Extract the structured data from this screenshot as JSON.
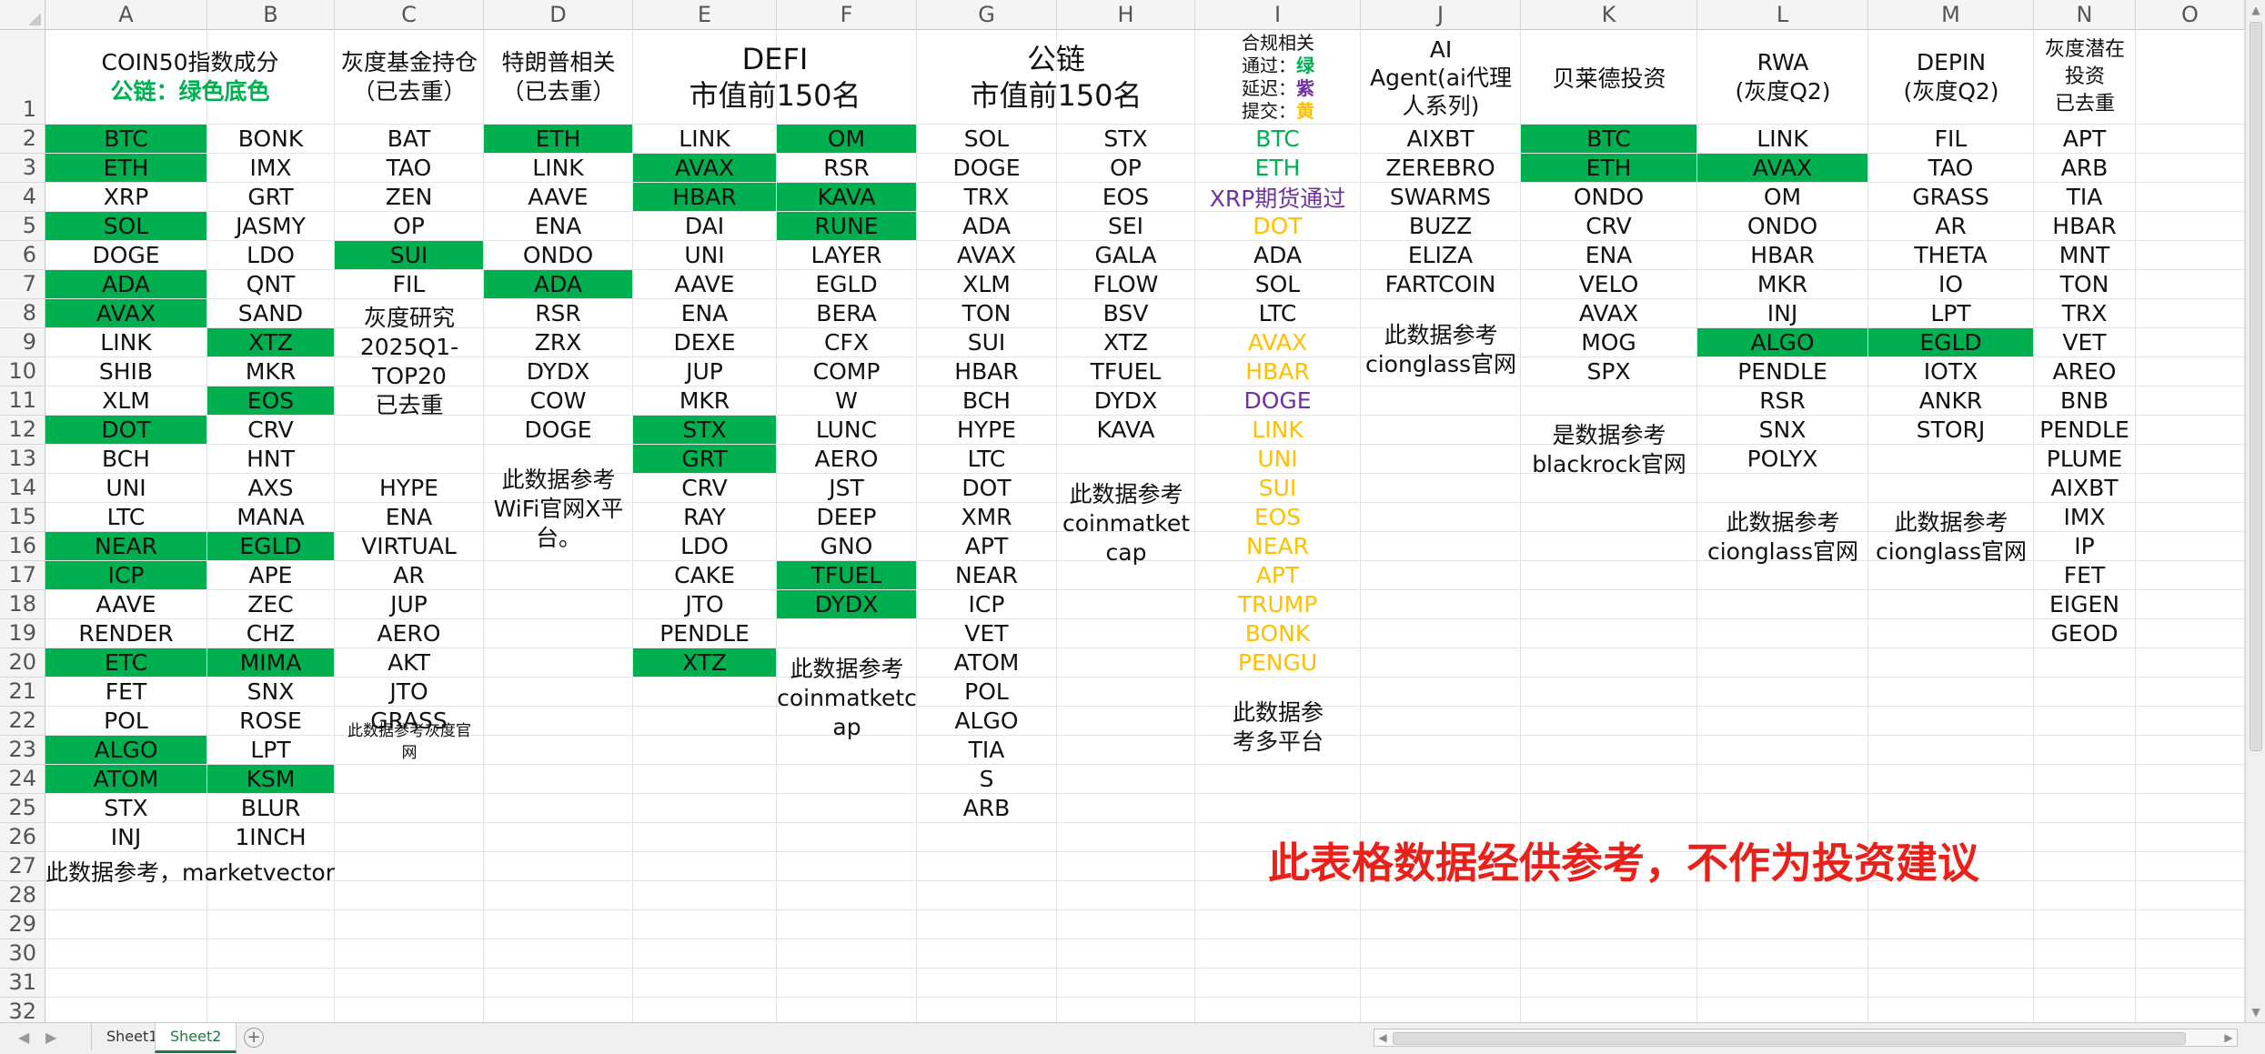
{
  "colors": {
    "green_fill": "#00b050",
    "green_text": "#00b050",
    "purple_text": "#7030a0",
    "yellow_text": "#ffc000",
    "red_text": "#e8211a"
  },
  "columns": [
    "A",
    "B",
    "C",
    "D",
    "E",
    "F",
    "G",
    "H",
    "I",
    "J",
    "K",
    "L",
    "M",
    "N",
    "O"
  ],
  "rows": [
    "1",
    "2",
    "3",
    "4",
    "5",
    "6",
    "7",
    "8",
    "9",
    "10",
    "11",
    "12",
    "13",
    "14",
    "15",
    "16",
    "17",
    "18",
    "19",
    "20",
    "21",
    "22",
    "23",
    "24",
    "25",
    "26",
    "27",
    "28",
    "29",
    "30",
    "31",
    "32"
  ],
  "headers": {
    "coin50": {
      "line1": "COIN50指数成分",
      "line2": "公链：绿色底色"
    },
    "grayscale": {
      "line1": "灰度基金持仓",
      "line2": "（已去重）"
    },
    "trump": {
      "line1": "特朗普相关",
      "line2": "（已去重）"
    },
    "defi": {
      "line1": "DEFI",
      "line2": "市值前150名"
    },
    "public_chain": {
      "line1": "公链",
      "line2": "市值前150名"
    },
    "compliance": {
      "line1": "合规相关",
      "pass_label": "通过：",
      "pass_value": "绿",
      "delay_label": "延迟：",
      "delay_value": "紫",
      "submit_label": "提交：",
      "submit_value": "黄"
    },
    "ai_agent": {
      "line1": "AI",
      "line2": "Agent(ai代理",
      "line3": "人系列)"
    },
    "blackrock": {
      "line1": "贝莱德投资"
    },
    "rwa": {
      "line1": "RWA",
      "line2": "(灰度Q2)"
    },
    "depin": {
      "line1": "DEPIN",
      "line2": "(灰度Q2)"
    },
    "grayscale_potential": {
      "line1": "灰度潜在",
      "line2": "投资",
      "line3": "已去重"
    }
  },
  "col_a": [
    "BTC",
    "ETH",
    "XRP",
    "SOL",
    "DOGE",
    "ADA",
    "AVAX",
    "LINK",
    "SHIB",
    "XLM",
    "DOT",
    "BCH",
    "UNI",
    "LTC",
    "NEAR",
    "ICP",
    "AAVE",
    "RENDER",
    "ETC",
    "FET",
    "POL",
    "ALGO",
    "ATOM",
    "STX",
    "INJ"
  ],
  "col_b": [
    "BONK",
    "IMX",
    "GRT",
    "JASMY",
    "LDO",
    "QNT",
    "SAND",
    "XTZ",
    "MKR",
    "EOS",
    "CRV",
    "HNT",
    "AXS",
    "MANA",
    "EGLD",
    "APE",
    "ZEC",
    "CHZ",
    "MIMA",
    "SNX",
    "ROSE",
    "LPT",
    "KSM",
    "BLUR",
    "1INCH"
  ],
  "col_c_top": [
    "BAT",
    "TAO",
    "ZEN",
    "OP",
    "SUI",
    "FIL"
  ],
  "col_c_note": {
    "line1": "灰度研究",
    "line2": "2025Q1-",
    "line3": "TOP20",
    "line4": "已去重"
  },
  "col_c_bottom": [
    "HYPE",
    "ENA",
    "VIRTUAL",
    "AR",
    "JUP",
    "AERO",
    "AKT",
    "JTO",
    "GRASS"
  ],
  "col_c_source": {
    "line1": "此数据参考灰度官",
    "line2": "网"
  },
  "col_d": [
    "ETH",
    "LINK",
    "AAVE",
    "ENA",
    "ONDO",
    "ADA",
    "RSR",
    "ZRX",
    "DYDX",
    "COW",
    "DOGE"
  ],
  "col_d_source": {
    "line1": "此数据参考",
    "line2": "WiFi官网X平",
    "line3": "台。"
  },
  "col_e": [
    "LINK",
    "AVAX",
    "HBAR",
    "DAI",
    "UNI",
    "AAVE",
    "ENA",
    "DEXE",
    "JUP",
    "MKR",
    "STX",
    "GRT",
    "CRV",
    "RAY",
    "LDO",
    "CAKE",
    "JTO",
    "PENDLE",
    "XTZ"
  ],
  "col_f": [
    "OM",
    "RSR",
    "KAVA",
    "RUNE",
    "LAYER",
    "EGLD",
    "BERA",
    "CFX",
    "COMP",
    "W",
    "LUNC",
    "AERO",
    "JST",
    "DEEP",
    "GNO",
    "TFUEL",
    "DYDX"
  ],
  "col_f_source": {
    "line1": "此数据参考",
    "line2": "coinmatketc",
    "line3": "ap"
  },
  "col_g": [
    "SOL",
    "DOGE",
    "TRX",
    "ADA",
    "AVAX",
    "XLM",
    "TON",
    "SUI",
    "HBAR",
    "BCH",
    "HYPE",
    "LTC",
    "DOT",
    "XMR",
    "APT",
    "NEAR",
    "ICP",
    "VET",
    "ATOM",
    "POL",
    "ALGO",
    "TIA",
    "S",
    "ARB"
  ],
  "col_h": [
    "STX",
    "OP",
    "EOS",
    "SEI",
    "GALA",
    "FLOW",
    "BSV",
    "XTZ",
    "TFUEL",
    "DYDX",
    "KAVA"
  ],
  "col_h_source": {
    "line1": "此数据参考",
    "line2": "coinmatket",
    "line3": "cap"
  },
  "col_i": [
    "BTC",
    "ETH",
    "XRP期货通过",
    "DOT",
    "ADA",
    "SOL",
    "LTC",
    "AVAX",
    "HBAR",
    "DOGE",
    "LINK",
    "UNI",
    "SUI",
    "EOS",
    "NEAR",
    "APT",
    "TRUMP",
    "BONK",
    "PENGU"
  ],
  "col_i_source": {
    "line1": "此数据参",
    "line2": "考多平台"
  },
  "col_j": [
    "AIXBT",
    "ZEREBRO",
    "SWARMS",
    "BUZZ",
    "ELIZA",
    "FARTCOIN"
  ],
  "col_j_source": {
    "line1": "此数据参考",
    "line2": "cionglass官网"
  },
  "col_k": [
    "BTC",
    "ETH",
    "ONDO",
    "CRV",
    "ENA",
    "VELO",
    "AVAX",
    "MOG",
    "SPX"
  ],
  "col_k_source": {
    "line1": "是数据参考",
    "line2": "blackrock官网"
  },
  "col_l": [
    "LINK",
    "AVAX",
    "OM",
    "ONDO",
    "HBAR",
    "MKR",
    "INJ",
    "ALGO",
    "PENDLE",
    "RSR",
    "SNX",
    "POLYX"
  ],
  "col_l_source": {
    "line1": "此数据参考",
    "line2": "cionglass官网"
  },
  "col_m": [
    "FIL",
    "TAO",
    "GRASS",
    "AR",
    "THETA",
    "IO",
    "LPT",
    "EGLD",
    "IOTX",
    "ANKR",
    "STORJ"
  ],
  "col_m_source": {
    "line1": "此数据参考",
    "line2": "cionglass官网"
  },
  "col_n": [
    "APT",
    "ARB",
    "TIA",
    "HBAR",
    "MNT",
    "TON",
    "TRX",
    "VET",
    "AREO",
    "BNB",
    "PENDLE",
    "PLUME",
    "AIXBT",
    "IMX",
    "IP",
    "FET",
    "EIGEN",
    "GEOD"
  ],
  "coin50_source": "此数据参考，marketvector",
  "disclaimer": "此表格数据经供参考，不作为投资建议",
  "sheet_tabs": [
    "Sheet1",
    "Sheet2"
  ],
  "active_tab": "Sheet2"
}
